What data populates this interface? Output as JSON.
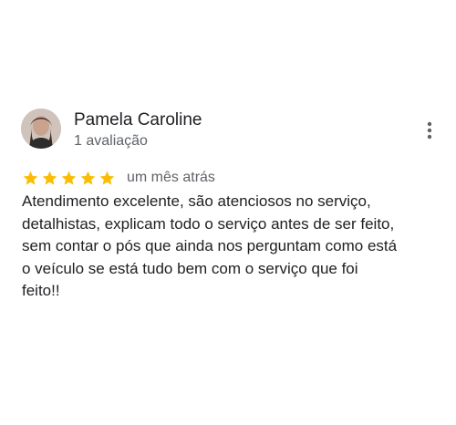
{
  "reviewer": {
    "name": "Pamela Caroline",
    "review_count": "1 avaliação"
  },
  "rating": {
    "stars": 5,
    "max_stars": 5,
    "star_color": "#FBBC04"
  },
  "date": "um mês atrás",
  "review": {
    "lines": [
      "Atendimento excelente, são atenciosos no serviço,",
      "detalhistas, explicam todo o serviço antes de ser feito,",
      "sem contar o pós que ainda nos perguntam como está",
      "o veículo se está tudo bem com o serviço que foi",
      "feito!!"
    ]
  },
  "icons": {
    "menu": "more-vertical-icon",
    "star": "star-icon"
  }
}
